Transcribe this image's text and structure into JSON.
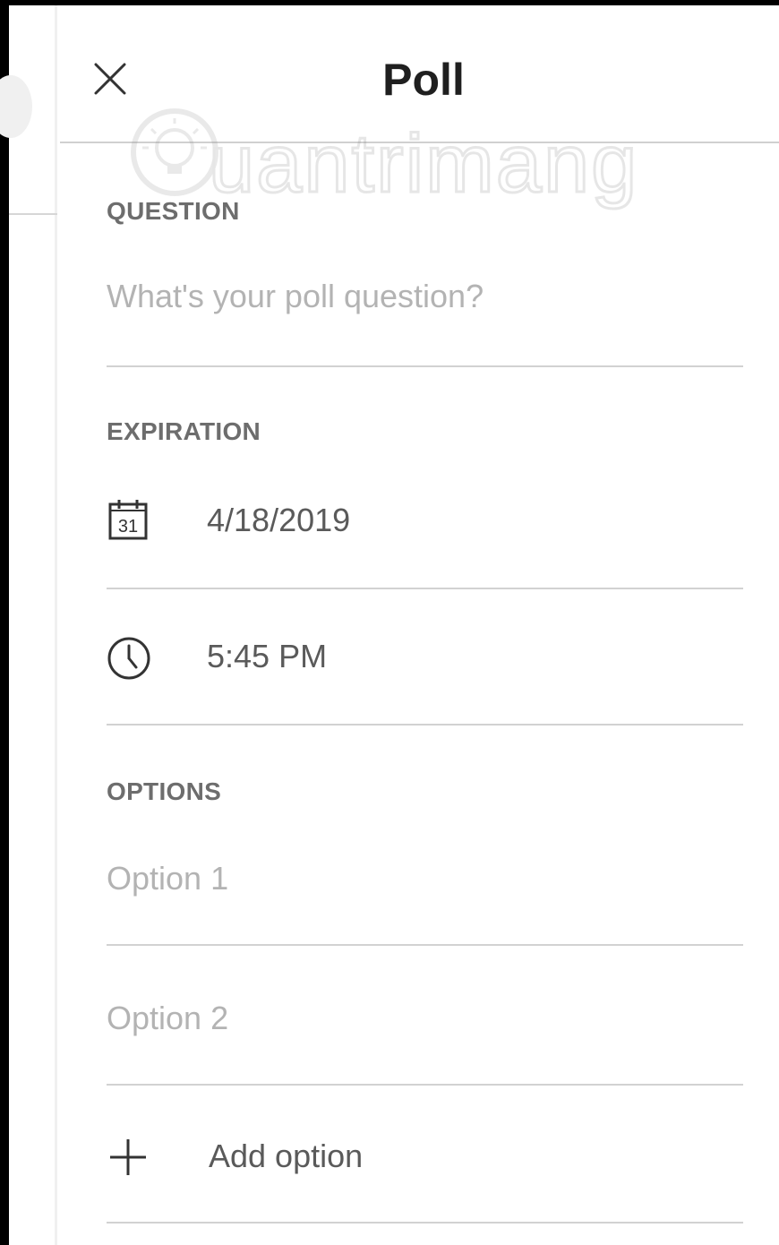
{
  "header": {
    "title": "Poll",
    "close_icon": "close-icon"
  },
  "question": {
    "label": "QUESTION",
    "placeholder": "What's your poll question?"
  },
  "expiration": {
    "label": "EXPIRATION",
    "date": "4/18/2019",
    "date_icon": "calendar-icon",
    "calendar_day": "31",
    "time": "5:45 PM",
    "time_icon": "clock-icon"
  },
  "options": {
    "label": "OPTIONS",
    "items": [
      {
        "placeholder": "Option 1"
      },
      {
        "placeholder": "Option 2"
      }
    ],
    "add_label": "Add option",
    "add_icon": "plus-icon"
  },
  "watermark": {
    "text": "Quantrimang"
  },
  "colors": {
    "title": "#1f1f1f",
    "section_label": "#6d6d6d",
    "placeholder": "#b3b3b3",
    "value": "#5a5a5a",
    "divider": "#d2d2d2",
    "frame_border": "#000000"
  }
}
